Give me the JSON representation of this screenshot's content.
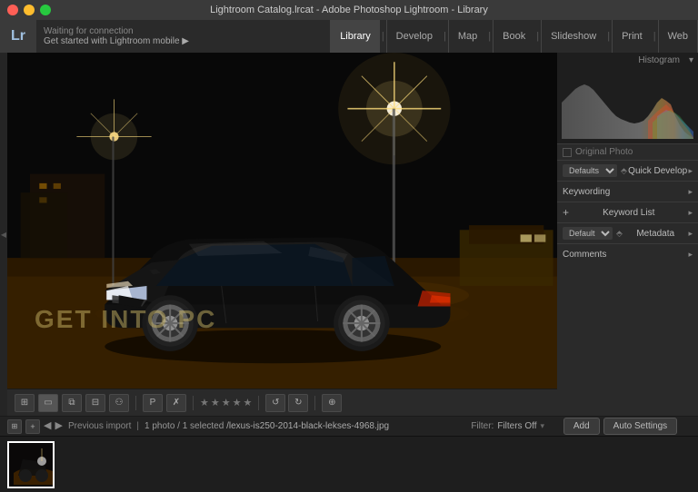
{
  "titleBar": {
    "title": "Lightroom Catalog.lrcat - Adobe Photoshop Lightroom - Library"
  },
  "topBar": {
    "logo": "Lr",
    "statusWaiting": "Waiting for connection",
    "statusMobile": "Get started with Lightroom mobile ▶",
    "navTabs": [
      "Library",
      "Develop",
      "Map",
      "Book",
      "Slideshow",
      "Print",
      "Web"
    ],
    "activeTab": "Library"
  },
  "rightPanel": {
    "histogramLabel": "Histogram",
    "originalPhotoLabel": "Original Photo",
    "sections": [
      {
        "label": "Quick Develop",
        "hasDropdown": true,
        "dropdownVal": "Defaults"
      },
      {
        "label": "Keywording",
        "hasPlus": false
      },
      {
        "label": "Keyword List",
        "hasPlus": true
      },
      {
        "label": "Metadata",
        "hasDropdown": true,
        "dropdownVal": "Default"
      },
      {
        "label": "Comments"
      }
    ]
  },
  "toolbar": {
    "viewModes": [
      "grid",
      "loupe",
      "compare",
      "survey"
    ],
    "stars": [
      0,
      0,
      0,
      0,
      0
    ],
    "flagLabel": "P",
    "rotateLeft": "↺",
    "rotateRight": "↻"
  },
  "statusBar": {
    "previousImport": "Previous import",
    "photoCount": "1 photo / 1 selected",
    "filePath": "/lexus-is250-2014-black-lekses-4968.jpg",
    "filterLabel": "Filter:",
    "filterValue": "Filters Off"
  },
  "filmstrip": {
    "thumbCount": 1
  },
  "watermark": "GET INTO PC",
  "bottomButtons": {
    "btn1": "Add",
    "btn2": "Auto Settings"
  },
  "colors": {
    "accent": "#a0c0e0",
    "bg": "#1a1a1a",
    "panel": "#2a2a2a",
    "active": "#444"
  }
}
